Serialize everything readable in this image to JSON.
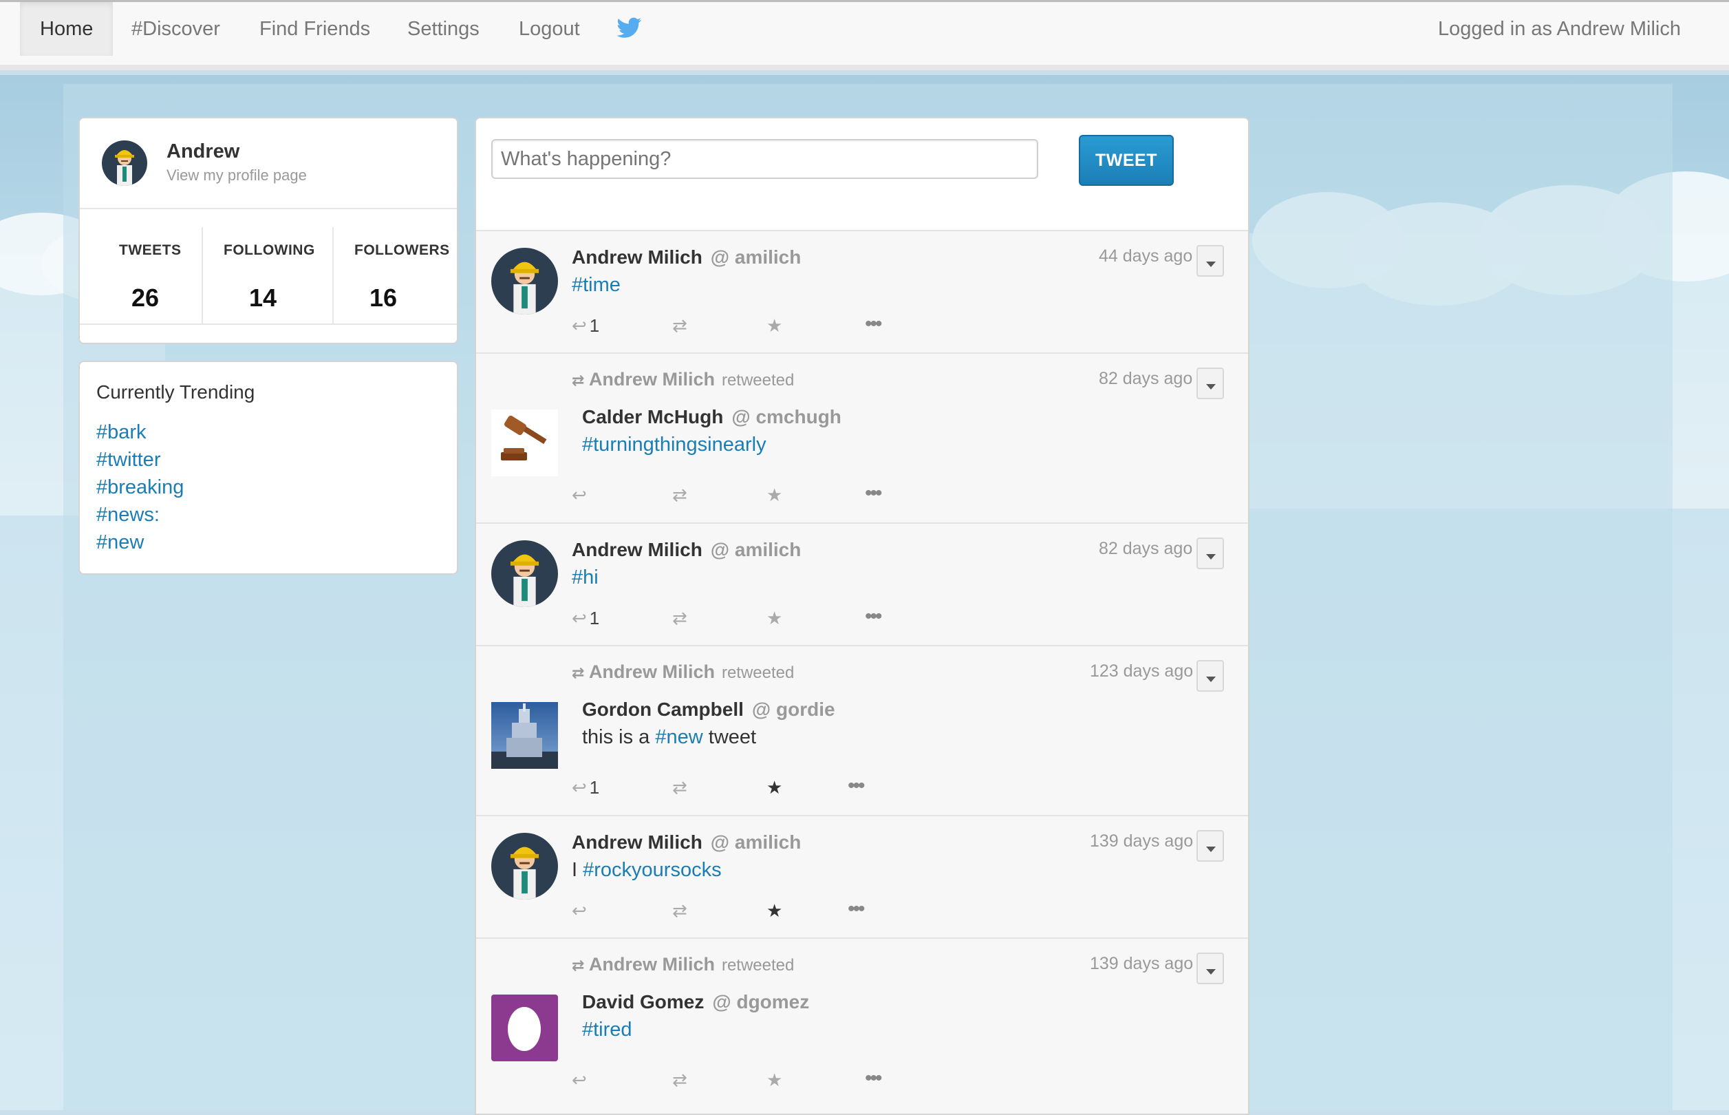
{
  "nav": {
    "items": [
      "Home",
      "#Discover",
      "Find Friends",
      "Settings",
      "Logout"
    ],
    "logged_in": "Logged in as Andrew Milich"
  },
  "profile": {
    "name": "Andrew",
    "link": "View my profile page",
    "stats": [
      {
        "label": "TWEETS",
        "value": "26"
      },
      {
        "label": "FOLLOWING",
        "value": "14"
      },
      {
        "label": "FOLLOWERS",
        "value": "16"
      }
    ]
  },
  "trending": {
    "title": "Currently Trending",
    "items": [
      "#bark",
      "#twitter",
      "#breaking",
      "#news:",
      "#new"
    ]
  },
  "composer": {
    "placeholder": "What's happening?",
    "button": "TWEET"
  },
  "tweets": [
    {
      "name": "Andrew Milich",
      "handle": "@ amilich",
      "text_tag": "#time",
      "time": "44 days ago",
      "reply_count": "1"
    },
    {
      "retweeter": "Andrew Milich",
      "retweeted": "retweeted",
      "name": "Calder McHugh",
      "handle": "@ cmchugh",
      "text_tag": "#turningthingsinearly",
      "time": "82 days ago",
      "reply_count": ""
    },
    {
      "name": "Andrew Milich",
      "handle": "@ amilich",
      "text_tag": "#hi",
      "time": "82 days ago",
      "reply_count": "1"
    },
    {
      "retweeter": "Andrew Milich",
      "retweeted": "retweeted",
      "name": "Gordon Campbell",
      "handle": "@ gordie",
      "text_pre": "this is a",
      "text_tag": "#new",
      "text_post": "tweet",
      "time": "123 days ago",
      "reply_count": "1",
      "starred": true
    },
    {
      "name": "Andrew Milich",
      "handle": "@ amilich",
      "text_pre": "I",
      "text_tag": "#rockyoursocks",
      "time": "139 days ago",
      "reply_count": "",
      "starred": true
    },
    {
      "retweeter": "Andrew Milich",
      "retweeted": "retweeted",
      "name": "David Gomez",
      "handle": "@ dgomez",
      "text_tag": "#tired",
      "time": "139 days ago",
      "reply_count": ""
    }
  ]
}
